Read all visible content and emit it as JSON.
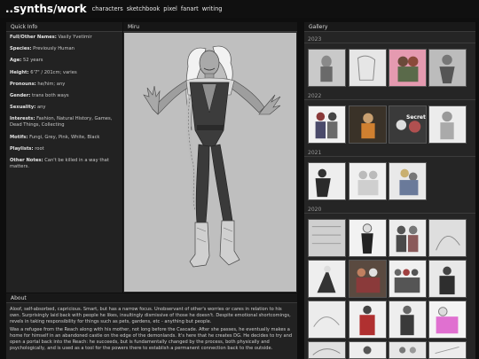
{
  "site": {
    "title": "..synths/work"
  },
  "nav": {
    "items": [
      "characters",
      "sketchbook",
      "pixel",
      "fanart",
      "writing"
    ]
  },
  "quick_info": {
    "header": "Quick Info",
    "rows": [
      {
        "label": "Full/Other Names:",
        "value": "Vasily Yvetimir"
      },
      {
        "label": "Species:",
        "value": "Previously Human"
      },
      {
        "label": "Age:",
        "value": "52 years"
      },
      {
        "label": "Height:",
        "value": "6'7\" / 201cm; varies"
      },
      {
        "label": "Pronouns:",
        "value": "he/him; any"
      },
      {
        "label": "Gender:",
        "value": "trans both ways"
      },
      {
        "label": "Sexuality:",
        "value": "any"
      },
      {
        "label": "Interests:",
        "value": "Fashion, Natural History, Games, Dead Things, Collecting"
      },
      {
        "label": "Motifs:",
        "value": "Fungi, Grey, Pink, White, Black"
      },
      {
        "label": "Playlists:",
        "value": "root"
      },
      {
        "label": "Other Notes:",
        "value": "Can't be killed in a way that matters."
      }
    ]
  },
  "figure": {
    "header": "Miru"
  },
  "about": {
    "header": "About",
    "paragraphs": [
      "Aloof, self-absorbed, capricious. Smart, but has a narrow focus. Unobservant of other's worries or cares in relation to his own. Surprisingly laid back with people he likes, insultingly dismissive of those he doesn't. Despite emotional shortcomings, revels in taking responsibility for things such as pets, gardens, etc - anything but people.",
      "Was a refugee from the Reach along with his mother, not long before the Cascade. After she passes, he eventually makes a home for himself in an abandoned castle on the edge of the demonlands. It's here that he creates DG. He decides to try and open a portal back into the Reach: he succeeds, but is fundamentally changed by the process, both physically and psychologically, and is used as a tool for the powers there to establish a permanent connection back to the outside."
    ]
  },
  "gallery": {
    "header": "Gallery",
    "years": [
      "2023",
      "2022",
      "2021",
      "2020"
    ],
    "thumb_caption": "Secret",
    "colors": {
      "accent_pink": "#e59ab0",
      "panel_bg": "#252525"
    }
  }
}
